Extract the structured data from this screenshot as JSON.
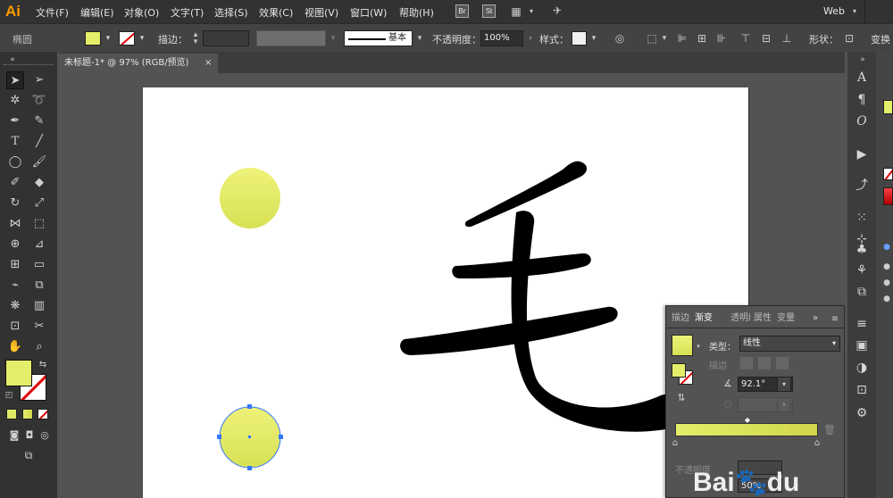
{
  "app": {
    "logo": "Ai"
  },
  "menubar": {
    "items": [
      "文件(F)",
      "编辑(E)",
      "对象(O)",
      "文字(T)",
      "选择(S)",
      "效果(C)",
      "视图(V)",
      "窗口(W)",
      "帮助(H)"
    ],
    "bridge_label": "Br",
    "stock_label": "St",
    "workspace": "Web"
  },
  "control_bar": {
    "object_type": "椭圆",
    "stroke_label": "描边：",
    "stroke_style": "基本",
    "opacity_label": "不透明度：",
    "opacity_value": "100%",
    "style_label": "样式：",
    "shape_label": "形状：",
    "transform_label": "变换"
  },
  "document_tab": {
    "title": "未标题-1* @ 97% (RGB/预览)",
    "close": "×"
  },
  "gradient_panel": {
    "tabs": [
      "描边",
      "渐变",
      "透明度",
      "属性",
      "变量"
    ],
    "active_tab": "渐变",
    "more": "»",
    "type_label": "类型：",
    "type_value": "线性",
    "stroke_label": "描边",
    "angle_value": "92.1°",
    "opacity_label": "不透明度",
    "location_value": "50%"
  },
  "colors": {
    "accent_yellow_light": "#e6ef6c",
    "accent_yellow": "#dfe865",
    "selection_blue": "#3377ff",
    "none_red": "#e00000",
    "watermark_blue": "#2a5fd6"
  },
  "watermark": {
    "text": "Bai",
    "text2": "du"
  }
}
